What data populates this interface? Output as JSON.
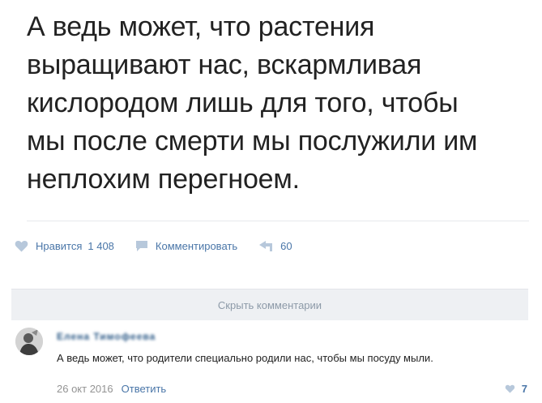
{
  "post": {
    "lines": [
      "А ведь может, что растения",
      "выращивают нас, вскармливая",
      "кислородом лишь для того, чтобы",
      "мы после смерти мы послужили им",
      "неплохим перегноем."
    ]
  },
  "actions": {
    "like_label": "Нравится",
    "like_count": "1 408",
    "comment_label": "Комментировать",
    "share_count": "60"
  },
  "comments_bar": {
    "hide_label": "Скрыть комментарии"
  },
  "comment": {
    "author": "Елена Тимофеева",
    "text": "А ведь может, что родители специально родили нас, чтобы мы посуду мыли.",
    "date": "26 окт 2016",
    "reply_label": "Ответить",
    "like_count": "7"
  },
  "colors": {
    "accent": "#4a76a8",
    "text": "#222222",
    "muted": "#939393",
    "bar_bg": "#eef0f3"
  }
}
